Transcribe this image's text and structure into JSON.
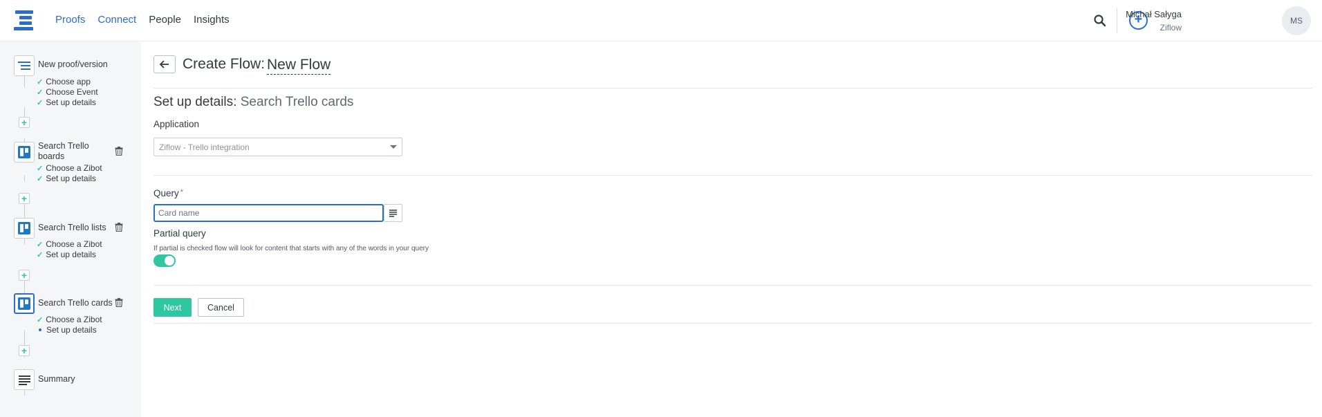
{
  "nav": {
    "items": [
      "Proofs",
      "Connect",
      "People",
      "Insights"
    ],
    "accent": "#2a6ccf"
  },
  "user": {
    "name": "Michał Sałyga",
    "org": "Ziflow",
    "initials": "MS"
  },
  "sidebar": {
    "steps": [
      {
        "title": "New proof/version",
        "icon": "lines-icon",
        "subs": [
          "Choose app",
          "Choose Event",
          "Set up details"
        ]
      },
      {
        "title": "Search Trello boards",
        "icon": "trello-icon",
        "subs": [
          "Choose a Zibot",
          "Set up details"
        ]
      },
      {
        "title": "Search Trello lists",
        "icon": "trello-icon",
        "subs": [
          "Choose a Zibot",
          "Set up details"
        ]
      },
      {
        "title": "Search Trello cards",
        "icon": "trello-icon",
        "subs": [
          "Choose a Zibot",
          "Set up details"
        ]
      }
    ],
    "summary": "Summary",
    "add_symbol": "+",
    "check_symbol": "✓"
  },
  "header": {
    "title": "Create Flow:",
    "flow_name": "New Flow"
  },
  "form": {
    "section_title": "Set up details:",
    "section_subtitle": "Search Trello cards",
    "application_label": "Application",
    "application_value": "Ziflow - Trello integration",
    "query_label": "Query",
    "required_mark": "*",
    "query_placeholder": "Card name",
    "partial_label": "Partial query",
    "partial_hint": "If partial is checked flow will look for content that starts with any of the words in your query",
    "partial_enabled": true
  },
  "actions": {
    "next": "Next",
    "cancel": "Cancel"
  },
  "colors": {
    "green": "#2fc7a0",
    "blue": "#2a6ccf",
    "trello": "#1f78c4"
  }
}
